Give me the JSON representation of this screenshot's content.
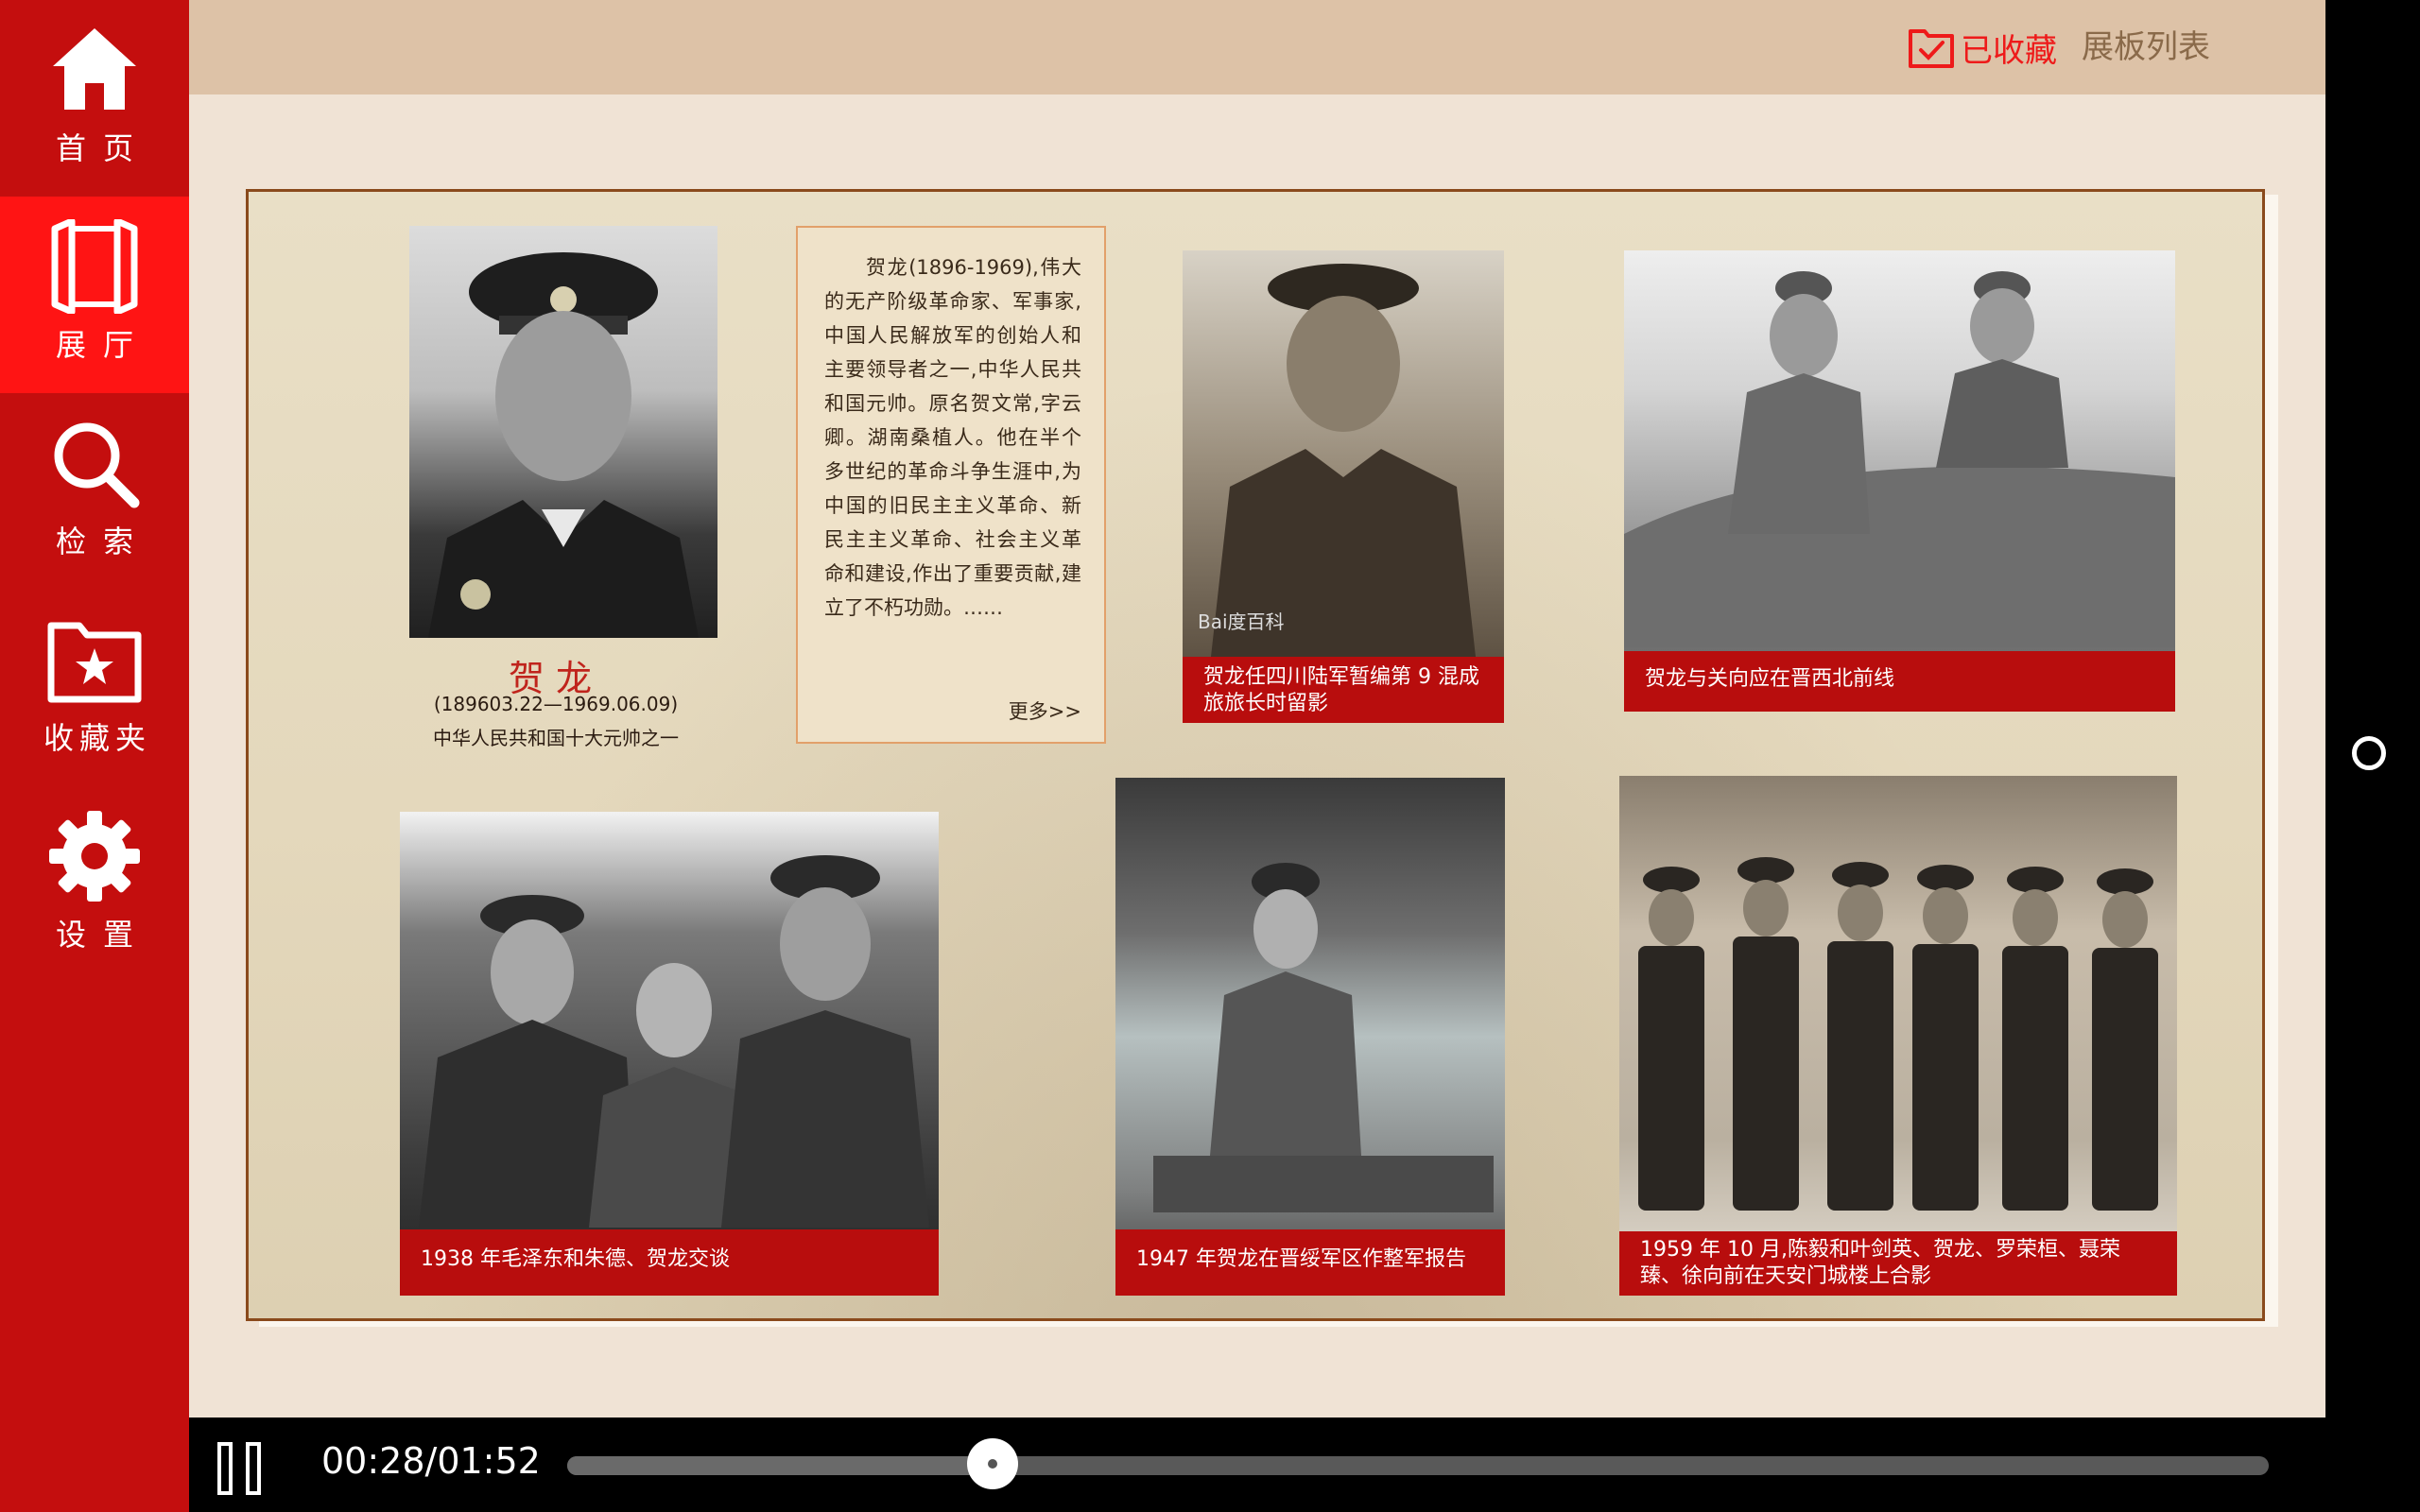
{
  "sidebar": {
    "items": [
      {
        "label": "首页",
        "icon": "home-icon"
      },
      {
        "label": "展厅",
        "icon": "exhibition-hall-icon"
      },
      {
        "label": "检索",
        "icon": "search-icon"
      },
      {
        "label": "收藏夹",
        "icon": "favorites-folder-icon"
      },
      {
        "label": "设置",
        "icon": "gear-icon"
      }
    ],
    "active_index": 1
  },
  "header": {
    "favorite_label": "已收藏",
    "board_list_label": "展板列表"
  },
  "board": {
    "name": "贺龙",
    "dates": "(189603.22—1969.06.09)",
    "subtitle": "中华人民共和国十大元帅之一",
    "bio": "贺龙(1896-1969),伟大的无产阶级革命家、军事家,中国人民解放军的创始人和主要领导者之一,中华人民共和国元帅。原名贺文常,字云卿。湖南桑植人。他在半个多世纪的革命斗争生涯中,为中国的旧民主主义革命、新民主主义革命、社会主义革命和建设,作出了重要贡献,建立了不朽功勋。……",
    "more_label": "更多>>",
    "photo_watermark": "Bai度百科",
    "captions": [
      "贺龙任四川陆军暂编第 9 混成旅旅长时留影",
      "贺龙与关向应在晋西北前线",
      "1938 年毛泽东和朱德、贺龙交谈",
      "1947 年贺龙在晋绥军区作整军报告",
      "1959 年 10 月,陈毅和叶剑英、贺龙、罗荣桓、聂荣臻、徐向前在天安门城楼上合影"
    ]
  },
  "player": {
    "current_time": "00:28",
    "separator": "/",
    "duration": "01:52",
    "progress": 0.25
  },
  "colors": {
    "sidebar_bg": "#c40e0e",
    "sidebar_active": "#ff1414",
    "topbar_bg": "#ddc2a7",
    "content_bg": "#f0e3d5",
    "caption_bg": "#b80d0d",
    "favorite_red": "#ee1a1a"
  }
}
